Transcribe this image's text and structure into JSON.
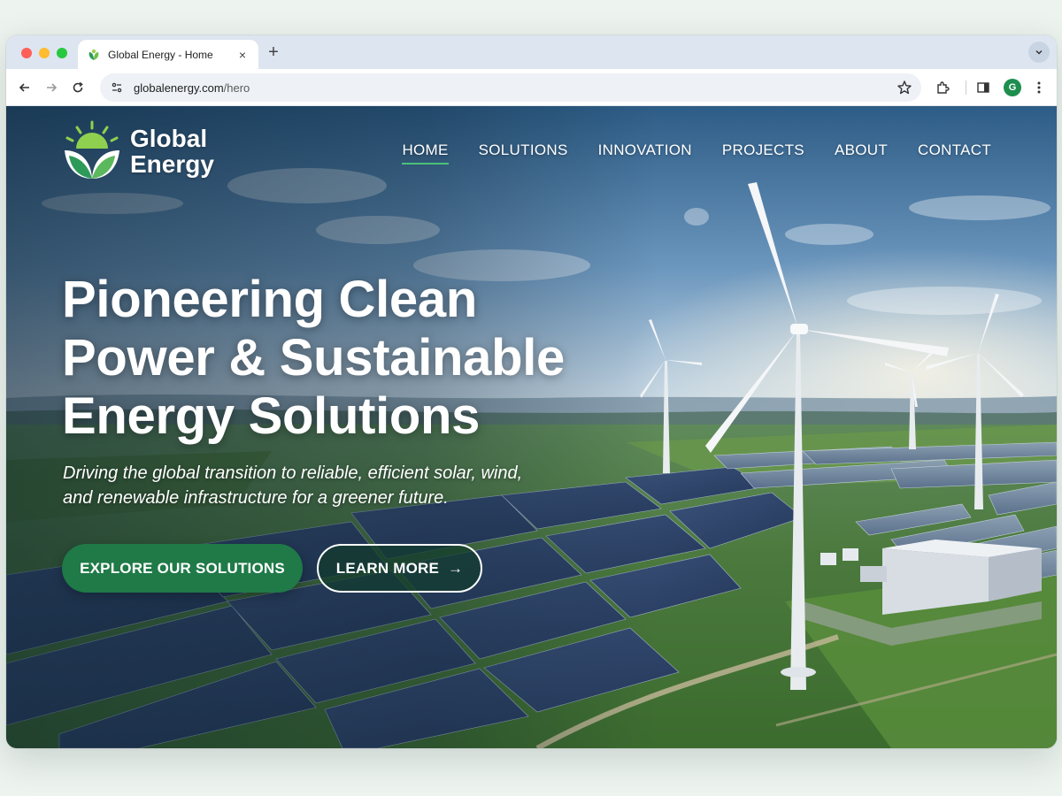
{
  "browser": {
    "tab_title": "Global Energy - Home",
    "new_tab_glyph": "+",
    "close_glyph": "×",
    "url_host": "globalenergy.com",
    "url_path": "/hero",
    "profile_initial": "G"
  },
  "site": {
    "logo_line1": "Global",
    "logo_line2": "Energy",
    "nav": [
      {
        "label": "HOME",
        "active": true
      },
      {
        "label": "SOLUTIONS",
        "active": false
      },
      {
        "label": "INNOVATION",
        "active": false
      },
      {
        "label": "PROJECTS",
        "active": false
      },
      {
        "label": "ABOUT",
        "active": false
      },
      {
        "label": "CONTACT",
        "active": false
      }
    ]
  },
  "hero": {
    "headline_1": "Pioneering Clean",
    "headline_2": "Power & Sustainable",
    "headline_3": "Energy Solutions",
    "subhead_1": "Driving the global transition to reliable, efficient solar, wind,",
    "subhead_2": "and renewable infrastructure for a greener future.",
    "primary_cta": "EXPLORE OUR SOLUTIONS",
    "secondary_cta": "LEARN MORE",
    "secondary_cta_arrow": "→"
  },
  "colors": {
    "brand_green": "#1f7a47",
    "accent_green": "#4cc07a",
    "logo_sun": "#8fd14f"
  }
}
